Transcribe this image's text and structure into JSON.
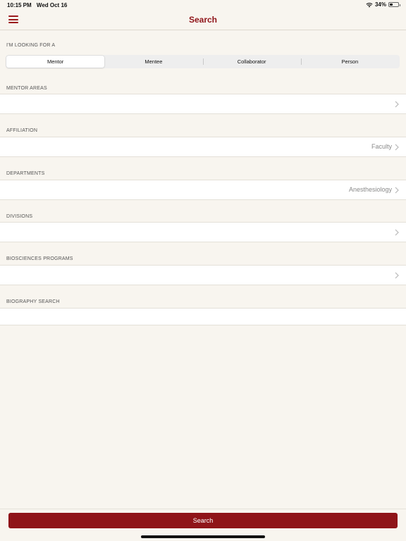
{
  "status_bar": {
    "time": "10:15 PM",
    "date": "Wed Oct 16",
    "battery_text": "34%",
    "battery_level": 0.34
  },
  "nav": {
    "title": "Search",
    "menu_icon": "hamburger-menu-icon"
  },
  "looking_for": {
    "header": "I'M LOOKING FOR A",
    "options": [
      "Mentor",
      "Mentee",
      "Collaborator",
      "Person"
    ],
    "selected": "Mentor"
  },
  "fields": {
    "mentor_areas": {
      "header": "MENTOR AREAS",
      "value": ""
    },
    "affiliation": {
      "header": "AFFILIATION",
      "value": "Faculty"
    },
    "departments": {
      "header": "DEPARTMENTS",
      "value": "Anesthesiology"
    },
    "divisions": {
      "header": "DIVISIONS",
      "value": ""
    },
    "biosciences_programs": {
      "header": "BIOSCIENCES PROGRAMS",
      "value": ""
    },
    "biography_search": {
      "header": "BIOGRAPHY SEARCH",
      "value": ""
    }
  },
  "footer": {
    "search_label": "Search"
  },
  "colors": {
    "accent": "#8f1419",
    "background": "#f8f5ef"
  }
}
